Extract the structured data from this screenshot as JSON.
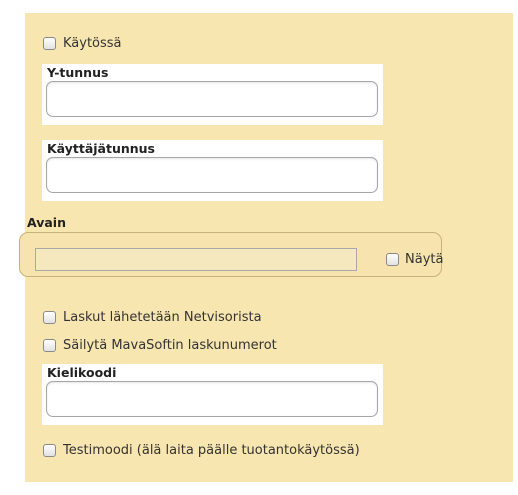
{
  "form": {
    "enabled": {
      "label": "Käytössä",
      "checked": false
    },
    "business_id": {
      "label": "Y-tunnus",
      "value": ""
    },
    "username": {
      "label": "Käyttäjätunnus",
      "value": ""
    },
    "key": {
      "label": "Avain",
      "value": "",
      "show_label": "Näytä",
      "show_checked": false
    },
    "send_invoices": {
      "label": "Laskut lähetetään Netvisorista",
      "checked": false
    },
    "keep_numbers": {
      "label": "Säilytä MavaSoftin laskunumerot",
      "checked": false
    },
    "language_code": {
      "label": "Kielikoodi",
      "value": ""
    },
    "test_mode": {
      "label": "Testimoodi (älä laita päälle tuotantokäytössä)",
      "checked": false
    }
  },
  "colors": {
    "panel": "#f8e6b0",
    "frame": "#c9b27a"
  }
}
